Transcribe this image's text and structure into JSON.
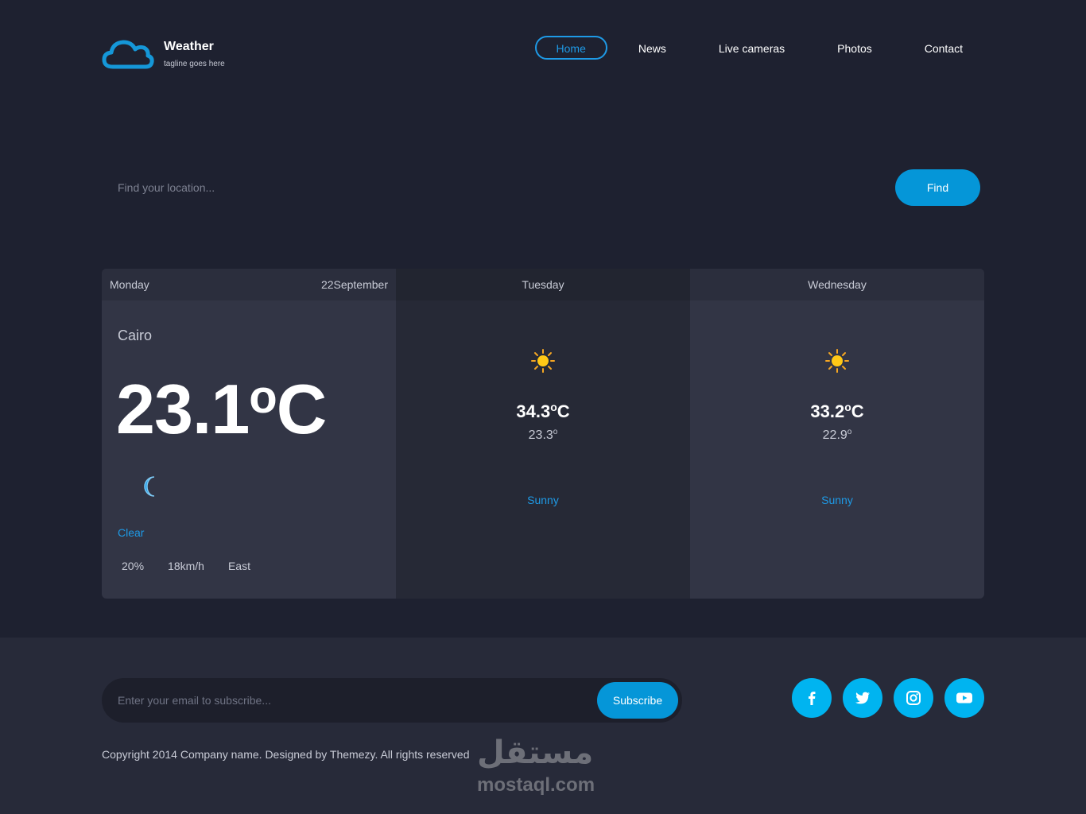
{
  "header": {
    "brand": {
      "title": "Weather",
      "tagline": "tagline goes here",
      "logo_icon": "cloud-icon"
    },
    "nav": [
      {
        "label": "Home",
        "active": true
      },
      {
        "label": "News",
        "active": false
      },
      {
        "label": "Live cameras",
        "active": false
      },
      {
        "label": "Photos",
        "active": false
      },
      {
        "label": "Contact",
        "active": false
      }
    ]
  },
  "search": {
    "placeholder": "Find your location...",
    "value": "",
    "button_label": "Find"
  },
  "forecast": {
    "today": {
      "day": "Monday",
      "date": "22September",
      "location": "Cairo",
      "temperature": "23.1",
      "degree_symbol": "o",
      "unit": "C",
      "icon": "moon-icon",
      "condition": "Clear",
      "humidity": "20%",
      "wind_speed": "18km/h",
      "wind_direction": "East"
    },
    "days": [
      {
        "day": "Tuesday",
        "icon": "sun-icon",
        "max_temp": "34.3",
        "max_degree": "o",
        "max_unit": "C",
        "min_temp": "23.3",
        "min_degree": "o",
        "condition": "Sunny"
      },
      {
        "day": "Wednesday",
        "icon": "sun-icon",
        "max_temp": "33.2",
        "max_degree": "o",
        "max_unit": "C",
        "min_temp": "22.9",
        "min_degree": "o",
        "condition": "Sunny"
      }
    ]
  },
  "footer": {
    "subscribe": {
      "placeholder": "Enter your email to subscribe...",
      "value": "",
      "button_label": "Subscribe"
    },
    "socials": [
      "facebook-icon",
      "twitter-icon",
      "instagram-icon",
      "youtube-icon"
    ],
    "copyright": "Copyright 2014 Company name. Designed by Themezy. All rights reserved",
    "watermark": {
      "arabic": "مستقل",
      "latin": "mostaql.com"
    }
  },
  "colors": {
    "background": "#1e2130",
    "footer": "#272a39",
    "accent": "#0596d8",
    "link": "#1e9ae6",
    "social": "#00b4f0",
    "card": "#323545",
    "card_dark": "#262936"
  }
}
